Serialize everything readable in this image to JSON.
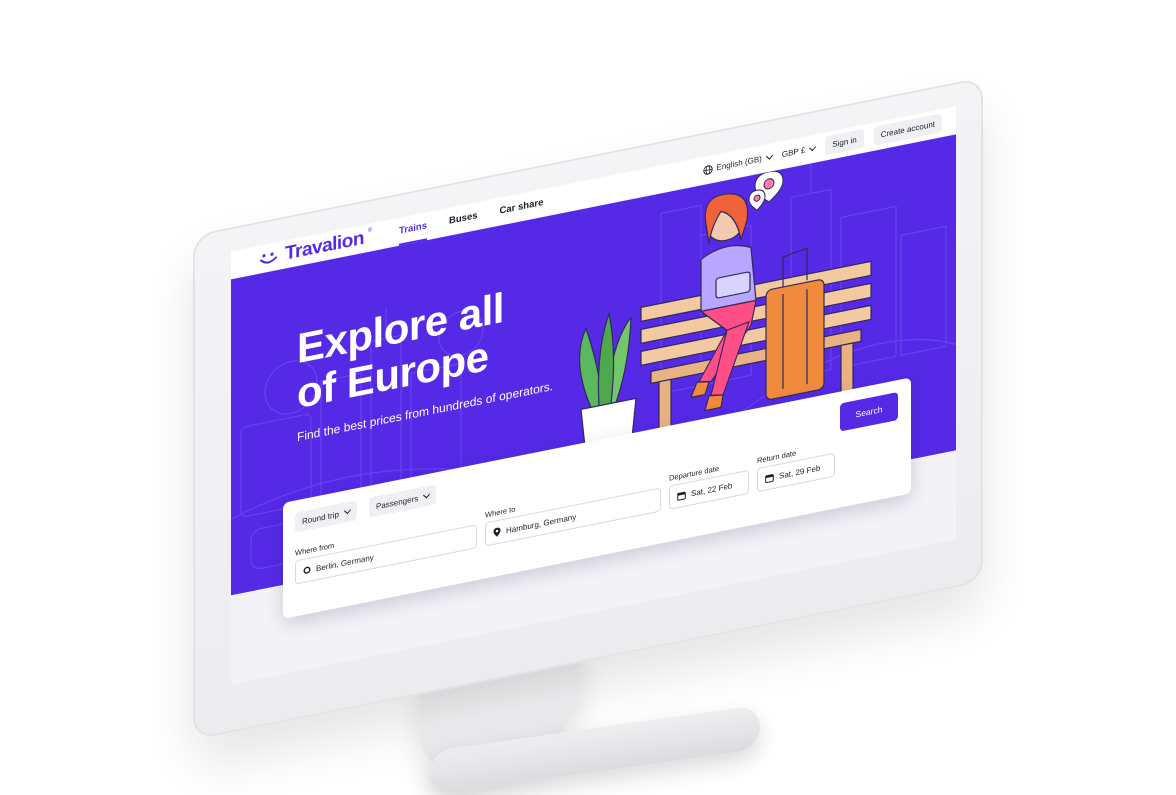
{
  "brand": {
    "name": "Travalion",
    "registered_mark": "®",
    "primary_color": "#5529e6",
    "accent_colors": [
      "#f08a3c",
      "#ff4f86",
      "#f2c9a0"
    ]
  },
  "nav": {
    "tabs": [
      {
        "label": "Trains",
        "active": true
      },
      {
        "label": "Buses",
        "active": false
      },
      {
        "label": "Car share",
        "active": false
      }
    ],
    "language": "English (GB)",
    "currency": "GBP £",
    "sign_in": "Sign in",
    "create_account": "Create account"
  },
  "hero": {
    "title_line1": "Explore all",
    "title_line2": "of Europe",
    "subtitle": "Find the best prices from hundreds of operators."
  },
  "search": {
    "trip_type": "Round trip",
    "passengers": "Passengers",
    "from_label": "Where from",
    "from_value": "Berlin, Germany",
    "to_label": "Where to",
    "to_value": "Hamburg, Germany",
    "departure_label": "Departure date",
    "departure_value": "Sat, 22 Feb",
    "return_label": "Return date",
    "return_value": "Sat, 29 Feb",
    "button": "Search"
  },
  "icons": {
    "globe": "globe-icon",
    "chevron": "chevron-down-icon",
    "origin": "circle-origin-icon",
    "destination": "map-pin-icon",
    "calendar": "calendar-icon"
  }
}
